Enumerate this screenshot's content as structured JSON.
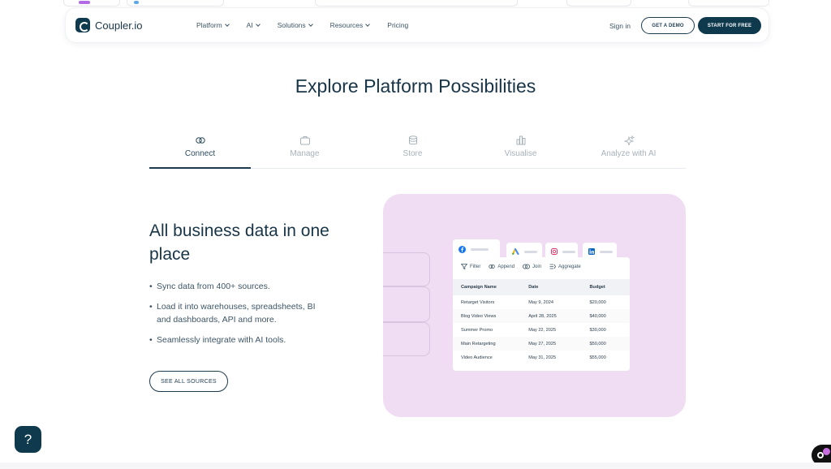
{
  "nav": {
    "logo": "Coupler.io",
    "links": [
      "Platform",
      "AI",
      "Solutions",
      "Resources",
      "Pricing"
    ],
    "sign_in": "Sign in",
    "demo": "GET A DEMO",
    "start": "START FOR FREE"
  },
  "title": "Explore Platform Possibilities",
  "tabs": [
    "Connect",
    "Manage",
    "Store",
    "Visualise",
    "Analyze with AI"
  ],
  "section": {
    "title": "All business data in one place",
    "bullets": [
      "Sync data from 400+ sources.",
      "Load it into warehouses, spreadsheets, BI and dashboards, API and more.",
      "Seamlessly integrate with AI tools."
    ],
    "cta": "SEE ALL SOURCES"
  },
  "illustration": {
    "toolbar": [
      "Filter",
      "Append",
      "Join",
      "Aggregate"
    ],
    "headers": [
      "Campaign Name",
      "Date",
      "Budget"
    ],
    "rows": [
      [
        "Retarget Visitors",
        "May 9, 2024",
        "$20,000"
      ],
      [
        "Blog Video Views",
        "April 28, 2025",
        "$40,000"
      ],
      [
        "Summer Promo",
        "May 22, 2025",
        "$30,000"
      ],
      [
        "Main Retargeting",
        "May 27, 2025",
        "$50,000"
      ],
      [
        "Video Audience",
        "May 31, 2025",
        "$55,000"
      ]
    ]
  },
  "help": "?",
  "colors": {
    "brand": "#0f3a4e",
    "panel": "#f1ddf3"
  }
}
